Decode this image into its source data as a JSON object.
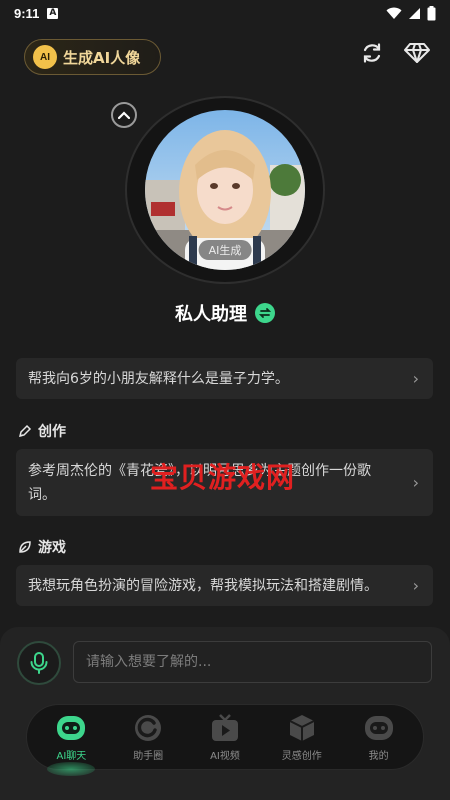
{
  "status_bar": {
    "time": "9:11",
    "notification_letter": "A"
  },
  "header": {
    "generate_button": {
      "badge": "AI",
      "label": "生成AI人像"
    },
    "refresh_icon": "refresh-icon",
    "vip_icon": "diamond-icon"
  },
  "avatar": {
    "tag": "AI生成"
  },
  "assistant": {
    "name": "私人助理"
  },
  "prompts": {
    "general": "帮我向6岁的小朋友解释什么是量子力学。",
    "creation_title": "创作",
    "creation": "参考周杰伦的《青花瓷》，以明月思乡为主题创作一份歌词。",
    "game_title": "游戏",
    "game": "我想玩角色扮演的冒险游戏，帮我模拟玩法和搭建剧情。"
  },
  "watermark": "宝贝游戏网",
  "input": {
    "placeholder": "请输入想要了解的..."
  },
  "tabs": [
    {
      "label": "AI聊天",
      "icon": "robot-icon",
      "active": true
    },
    {
      "label": "助手圈",
      "icon": "circle-icon",
      "active": false
    },
    {
      "label": "AI视频",
      "icon": "tv-icon",
      "active": false
    },
    {
      "label": "灵感创作",
      "icon": "cube-icon",
      "active": false
    },
    {
      "label": "我的",
      "icon": "profile-robot-icon",
      "active": false
    }
  ],
  "colors": {
    "accent": "#3dd68c",
    "gold": "#f1d79a",
    "background": "#1c1c1c"
  }
}
